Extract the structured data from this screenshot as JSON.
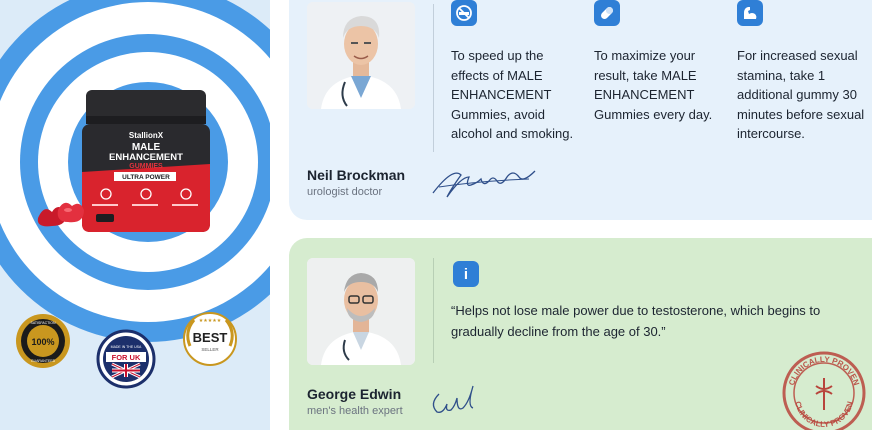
{
  "product": {
    "brand": "StallionX",
    "name_line1": "MALE",
    "name_line2": "ENHANCEMENT",
    "name_line3": "GUMMIES",
    "band": "ULTRA POWER",
    "accent_color": "#d9232d"
  },
  "badges": {
    "guarantee": {
      "top": "SATISFACTION",
      "center": "100%",
      "bottom": "GUARANTEED"
    },
    "made_in": {
      "top": "MADE IN THE USA",
      "center": "FOR UK"
    },
    "best": {
      "title": "BEST",
      "subtitle": "SELLER"
    }
  },
  "doctor_1": {
    "name": "Neil Brockman",
    "role": "urologist doctor",
    "tips": [
      {
        "icon": "no-smoking-icon",
        "text": "To speed up the effects of MALE ENHANCEMENT Gummies, avoid alcohol and smoking."
      },
      {
        "icon": "pill-icon",
        "text": "To maximize your result, take MALE ENHANCEMENT Gummies every day."
      },
      {
        "icon": "muscle-arm-icon",
        "text": "For increased sexual stamina, take 1 additional gummy 30 minutes before sexual intercourse."
      }
    ]
  },
  "doctor_2": {
    "name": "George Edwin",
    "role": "men's health expert",
    "quote": "“Helps not lose male power due to testosterone, which begins to gradually decline from the age of 30.”",
    "stamp_text": "CLINICALLY PROVEN"
  },
  "colors": {
    "card_blue": "#e6f1fb",
    "card_green": "#d6eccf",
    "icon_blue": "#2f7fd6",
    "stamp_red": "#b8453c"
  }
}
